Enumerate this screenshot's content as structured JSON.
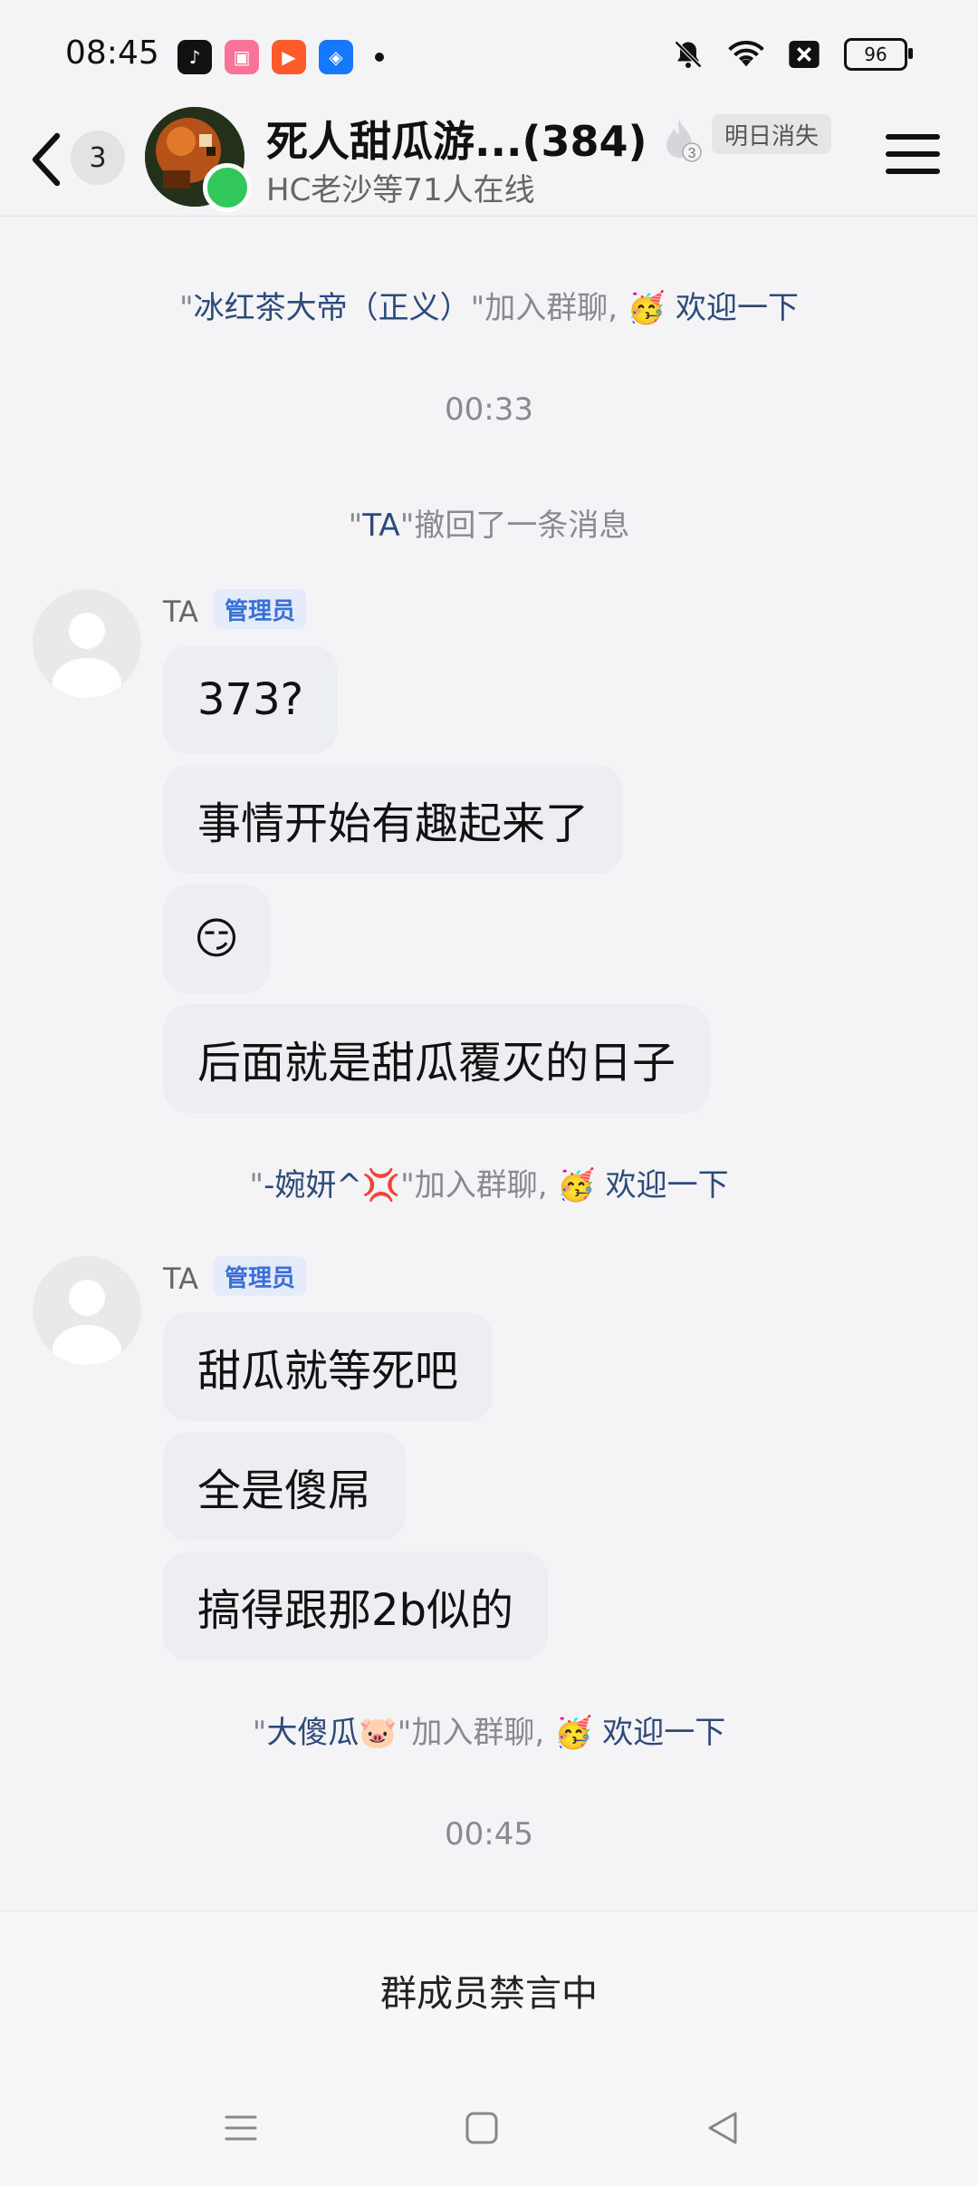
{
  "status_bar": {
    "time": "08:45",
    "app_icons": [
      "tiktok-icon",
      "bilibili-icon",
      "video-icon",
      "shield-icon"
    ],
    "status_icons": [
      "mute-bell-icon",
      "wifi-icon",
      "sim-off-icon"
    ],
    "battery": "96"
  },
  "header": {
    "back_icon": "chevron-left-icon",
    "unread_count": "3",
    "group_title": "死人甜瓜游...(384)",
    "online_text": "HC老沙等71人在线",
    "fire_count": "3",
    "tag": "明日消失",
    "menu_icon": "hamburger-icon"
  },
  "messages": {
    "sys1": {
      "pre": "\"",
      "name": "冰红茶大帝（正义）",
      "post": "\"加入群聊, ",
      "emoji": "🥳",
      "welcome": " 欢迎一下"
    },
    "time1": "00:33",
    "sys2": {
      "pre": "\"",
      "name": "TA",
      "post": "\"撤回了一条消息"
    },
    "group1": {
      "sender": "TA",
      "role": "管理员",
      "bubbles": [
        "373?",
        "事情开始有趣起来了",
        "😏",
        "后面就是甜瓜覆灭的日子"
      ]
    },
    "sys3": {
      "pre": "\"",
      "name": "-婉妍^💢",
      "post": "\"加入群聊, ",
      "emoji": "🥳",
      "welcome": " 欢迎一下"
    },
    "group2": {
      "sender": "TA",
      "role": "管理员",
      "bubbles": [
        "甜瓜就等死吧",
        "全是傻屌",
        "搞得跟那2b似的"
      ]
    },
    "sys4": {
      "pre": "\"",
      "name": "大傻瓜🐷",
      "post": "\"加入群聊, ",
      "emoji": "🥳",
      "welcome": " 欢迎一下"
    },
    "time2": "00:45"
  },
  "bottom": {
    "mute_text": "群成员禁言中",
    "nav_icons": [
      "menu-nav-icon",
      "home-nav-icon",
      "back-nav-icon"
    ]
  },
  "colors": {
    "background": "#f4f4f6",
    "bubble": "#eceef1",
    "role_tag_bg": "#e4ecfb",
    "role_tag_text": "#3a6fd8",
    "online": "#31c75a",
    "system_name": "#2d4a7a"
  }
}
